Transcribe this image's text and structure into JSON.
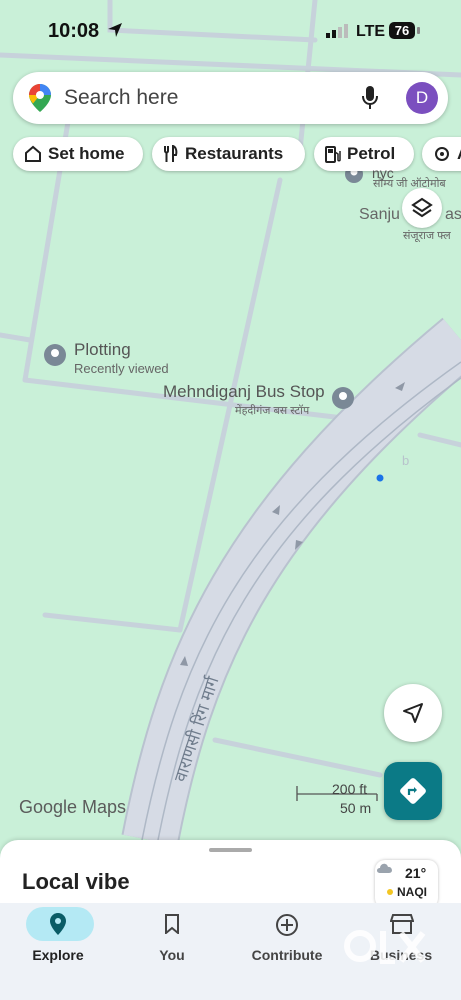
{
  "status_bar": {
    "time": "10:08",
    "network": "LTE",
    "battery": "76"
  },
  "search": {
    "placeholder": "Search here",
    "avatar_letter": "D"
  },
  "chips": [
    {
      "label": "Set home",
      "icon": "home-icon"
    },
    {
      "label": "Restaurants",
      "icon": "restaurant-icon"
    },
    {
      "label": "Petrol",
      "icon": "fuel-icon"
    },
    {
      "label": "A",
      "icon": "attraction-icon"
    }
  ],
  "map": {
    "places": {
      "plotting": {
        "name": "Plotting",
        "sub": "Recently viewed"
      },
      "bus_stop": {
        "name": "Mehndiganj Bus Stop",
        "native": "मेंहदीगंज बस स्टॉप"
      },
      "sanju": {
        "name": "Sanju",
        "suffix": "as",
        "native": "संजूराज फ्ल"
      },
      "saumya": {
        "name": "nyc",
        "native": "सौम्य जी ऑटोमोब"
      }
    },
    "road_name": "वाराणसी रिंग मार्ग",
    "scale": {
      "ft": "200 ft",
      "m": "50 m"
    },
    "attribution": "Google Maps",
    "route_color": "#c9cfdc",
    "land_color": "#c9f0d8"
  },
  "sheet": {
    "title": "Local vibe",
    "weather": {
      "temp": "21°",
      "aqi": "NAQI"
    }
  },
  "nav": {
    "items": [
      {
        "label": "Explore",
        "icon": "explore-pin-icon",
        "active": true
      },
      {
        "label": "You",
        "icon": "bookmark-icon",
        "active": false
      },
      {
        "label": "Contribute",
        "icon": "add-circle-icon",
        "active": false
      },
      {
        "label": "Business",
        "icon": "storefront-icon",
        "active": false
      }
    ]
  },
  "watermark": "OLX"
}
